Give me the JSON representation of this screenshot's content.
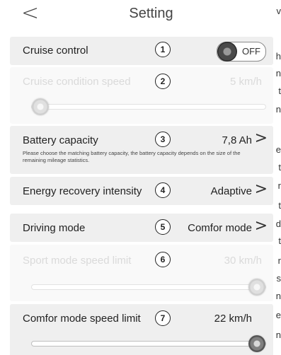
{
  "edge_text": [
    "v",
    "h",
    "n",
    "t",
    "n",
    "e",
    "t",
    "r",
    "t",
    "d",
    "t",
    "r",
    "s",
    "n",
    "e",
    "n"
  ],
  "header": {
    "back_icon": "chevron-left-icon",
    "back_glyph": "<",
    "title": "Setting"
  },
  "cruise": {
    "label": "Cruise control",
    "number": "1",
    "toggle_text": "OFF",
    "toggle_state": "off"
  },
  "cruise_speed": {
    "label": "Cruise condition speed",
    "number": "2",
    "value": "5 km/h",
    "slider_level": 0.0,
    "enabled": false
  },
  "battery": {
    "label": "Battery capacity",
    "number": "3",
    "value": "7,8 Ah",
    "chevron": ">",
    "note": "Please choose the matching battery capacity, the battery capacity depends on the size of the remaining mileage statistics."
  },
  "energy": {
    "label": "Energy recovery intensity",
    "number": "4",
    "value": "Adaptive",
    "chevron": ">"
  },
  "driving": {
    "label": "Driving mode",
    "number": "5",
    "value": "Comfor mode",
    "chevron": ">"
  },
  "sport_limit": {
    "label": "Sport mode speed limit",
    "number": "6",
    "value": "30 km/h",
    "slider_level": 1.0,
    "enabled": false
  },
  "comfort_limit": {
    "label": "Comfor mode speed limit",
    "number": "7",
    "value": "22 km/h",
    "slider_level": 1.0,
    "enabled": true
  }
}
